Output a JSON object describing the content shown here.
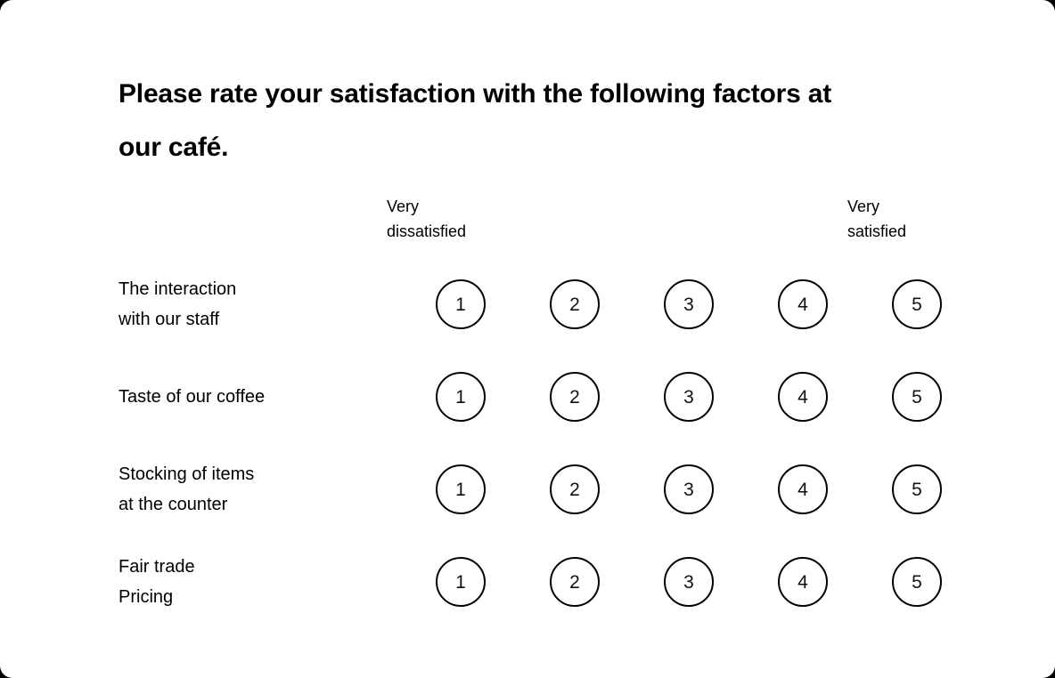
{
  "card": {
    "background": "#ffffff",
    "text_color": "#000000",
    "border_radius": "14px"
  },
  "question": {
    "title": "Please rate your satisfaction with the following factors at  our café."
  },
  "scale": {
    "low_label": "Very\ndissatisfied",
    "high_label": "Very\nsatisfied",
    "options": [
      "1",
      "2",
      "3",
      "4",
      "5"
    ]
  },
  "rows": [
    {
      "id": "interaction-with-staff",
      "label_lines": [
        "The interaction",
        "with our staff"
      ],
      "options": [
        "1",
        "2",
        "3",
        "4",
        "5"
      ],
      "selected": null
    },
    {
      "id": "taste-of-coffee",
      "label_lines": [
        "Taste of our coffee"
      ],
      "options": [
        "1",
        "2",
        "3",
        "4",
        "5"
      ],
      "selected": null
    },
    {
      "id": "stocking-of-items",
      "label_lines": [
        "Stocking of items",
        "at the counter"
      ],
      "options": [
        "1",
        "2",
        "3",
        "4",
        "5"
      ],
      "selected": null
    },
    {
      "id": "fair-trade-pricing",
      "label_lines": [
        "Fair trade",
        "Pricing"
      ],
      "options": [
        "1",
        "2",
        "3",
        "4",
        "5"
      ],
      "selected": null
    }
  ]
}
